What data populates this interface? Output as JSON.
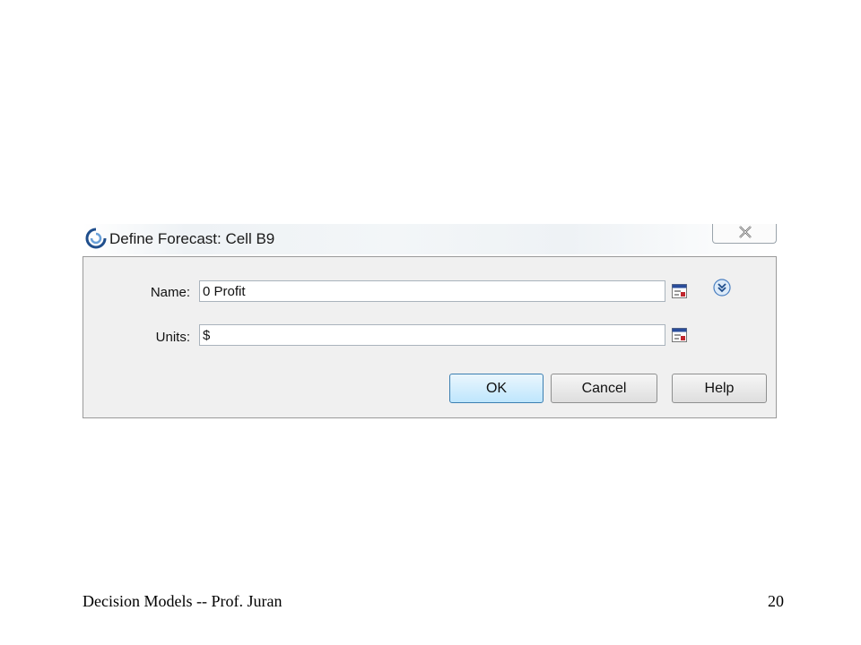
{
  "dialog": {
    "title": "Define Forecast: Cell B9",
    "icon": "crystal-ball-swirl-icon",
    "close_icon": "close-icon",
    "fields": {
      "name_label": "Name:",
      "name_value": "0 Profit",
      "units_label": "Units:",
      "units_value": "$",
      "cell_reference_icon": "cell-reference-icon",
      "expand_icon": "chevron-double-down-icon"
    },
    "buttons": {
      "ok": "OK",
      "cancel": "Cancel",
      "help": "Help"
    }
  },
  "slide": {
    "footer_left": "Decision Models --   Prof. Juran",
    "page_number": "20"
  },
  "colors": {
    "accent": "#3c7fb1",
    "dialog_bg": "#f0f0f0"
  }
}
